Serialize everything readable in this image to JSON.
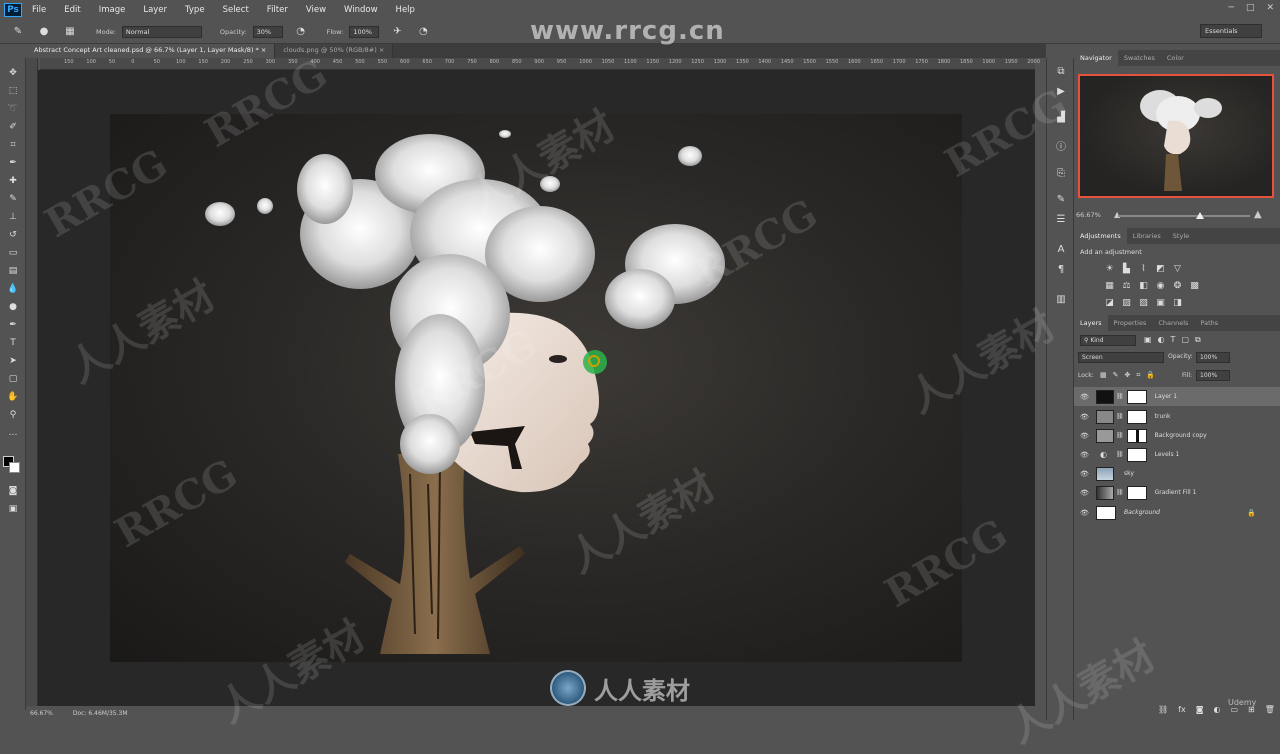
{
  "app": {
    "logo": "Ps"
  },
  "menu": [
    "File",
    "Edit",
    "Image",
    "Layer",
    "Type",
    "Select",
    "Filter",
    "View",
    "Window",
    "Help"
  ],
  "options": {
    "mode_label": "Mode:",
    "mode_value": "Normal",
    "opacity_label": "Opacity:",
    "opacity_value": "30%",
    "flow_label": "Flow:",
    "flow_value": "100%",
    "workspace": "Essentials"
  },
  "tabs": [
    {
      "label": "Abstract Concept Art cleaned.psd @ 66.7% (Layer 1, Layer Mask/8) *",
      "close": "×"
    },
    {
      "label": "clouds.png @ 50% (RGB/8#)",
      "close": "×"
    }
  ],
  "ruler": [
    "150",
    "100",
    "50",
    "0",
    "50",
    "100",
    "150",
    "200",
    "250",
    "300",
    "350",
    "400",
    "450",
    "500",
    "550",
    "600",
    "650",
    "700",
    "750",
    "800",
    "850",
    "900",
    "950",
    "1000",
    "1050",
    "1100",
    "1150",
    "1200",
    "1250",
    "1300",
    "1350",
    "1400",
    "1450",
    "1500",
    "1550",
    "1600",
    "1650",
    "1700",
    "1750",
    "1800",
    "1850",
    "1900",
    "1950",
    "2000"
  ],
  "status": {
    "zoom": "66.67%",
    "doc": "Doc: 6.46M/35.3M"
  },
  "navigator": {
    "tabs": [
      "Navigator",
      "Swatches",
      "Color"
    ],
    "zoom": "66.67%",
    "zoom_fraction": 0.62
  },
  "adjustments": {
    "tabs": [
      "Adjustments",
      "Libraries",
      "Style"
    ],
    "add_label": "Add an adjustment"
  },
  "layers_panel": {
    "tabs": [
      "Layers",
      "Properties",
      "Channels",
      "Paths"
    ],
    "kind": "Kind",
    "blend": "Screen",
    "opacity_label": "Opacity:",
    "opacity": "100%",
    "lock_label": "Lock:",
    "fill_label": "Fill:",
    "fill": "100%",
    "layers": [
      {
        "name": "Layer 1",
        "selected": true
      },
      {
        "name": "trunk"
      },
      {
        "name": "Background copy"
      },
      {
        "name": "Levels 1"
      },
      {
        "name": "sky"
      },
      {
        "name": "Gradient Fill 1"
      },
      {
        "name": "Background"
      }
    ]
  },
  "watermarks": {
    "top": "www.rrcg.cn",
    "bottom": "人人素材",
    "tiles": [
      "RRCG",
      "人人素材"
    ],
    "udemy": "Udemy"
  },
  "colors": {
    "bg": "#535353",
    "canvas": "#282828",
    "highlight": "#e5533d"
  }
}
